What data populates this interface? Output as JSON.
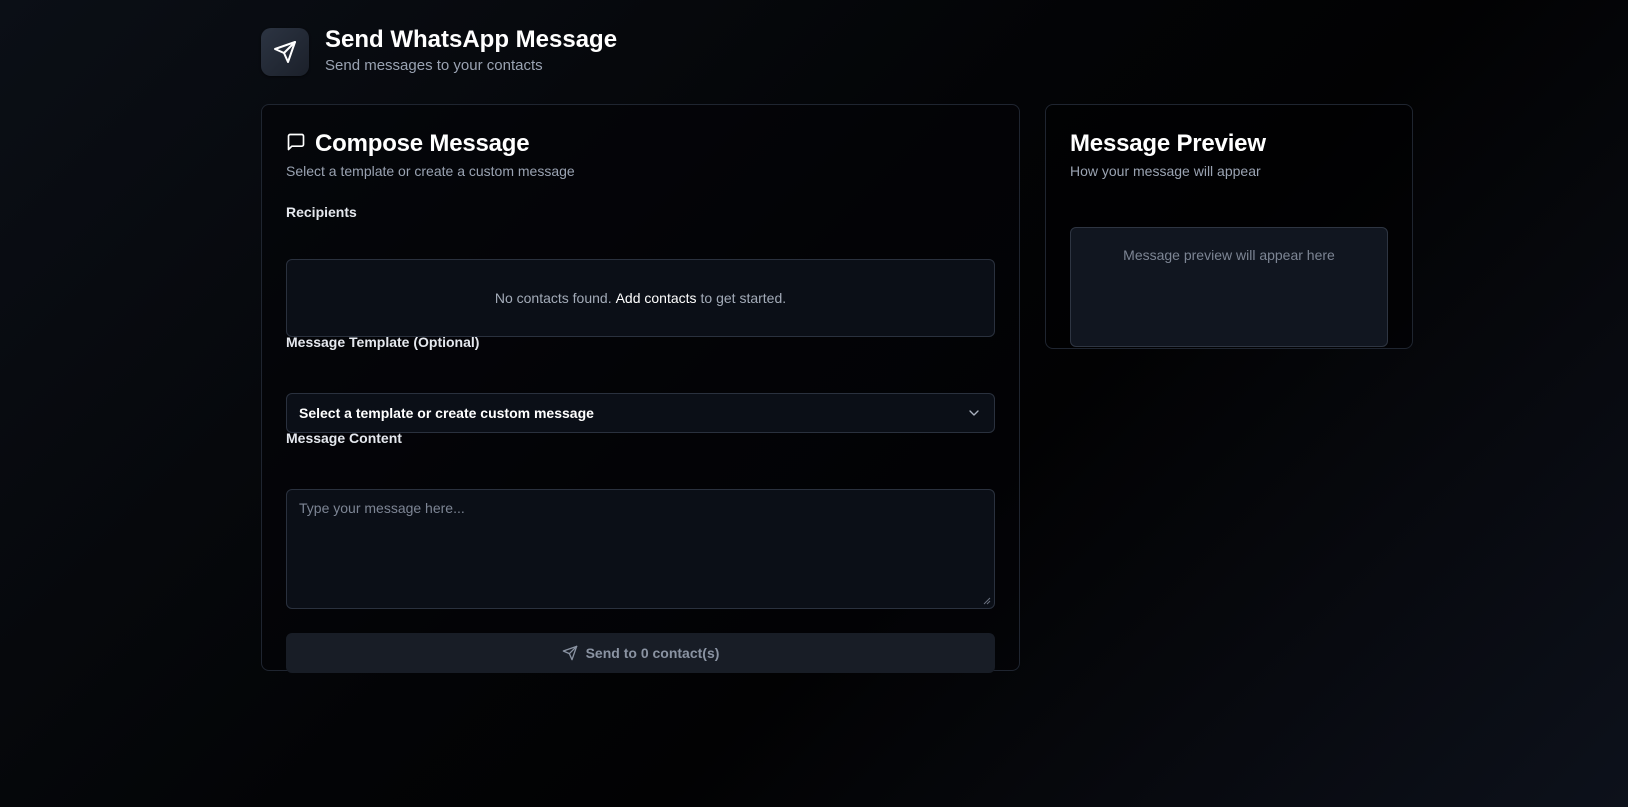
{
  "header": {
    "icon": "send-icon",
    "title": "Send WhatsApp Message",
    "subtitle": "Send messages to your contacts"
  },
  "compose": {
    "icon": "message-square-icon",
    "title": "Compose Message",
    "description": "Select a template or create a custom message",
    "recipients": {
      "label": "Recipients",
      "empty_prefix": "No contacts found.",
      "empty_link": "Add contacts",
      "empty_suffix": "to get started."
    },
    "template": {
      "label": "Message Template (Optional)",
      "selected": "Select a template or create custom message",
      "icon": "chevron-down-icon"
    },
    "content": {
      "label": "Message Content",
      "placeholder": "Type your message here...",
      "value": ""
    },
    "send_button": {
      "label": "Send to 0 contact(s)",
      "icon": "send-icon"
    }
  },
  "preview": {
    "title": "Message Preview",
    "description": "How your message will appear",
    "placeholder": "Message preview will appear here"
  },
  "colors": {
    "background": "#030406",
    "card_border": "#1f2530",
    "input_bg": "#0b0f17",
    "button_bg": "#181d26",
    "muted_text": "#9aa3b2"
  }
}
